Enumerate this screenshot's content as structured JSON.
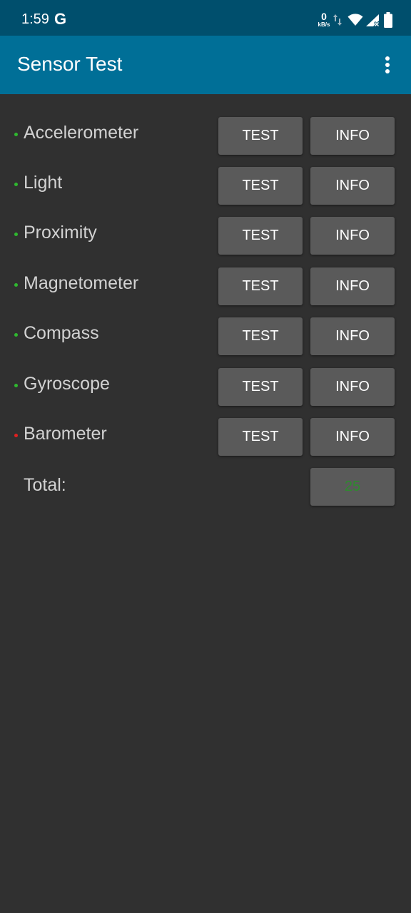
{
  "status_bar": {
    "time": "1:59",
    "g_logo": "G",
    "net_speed_value": "0",
    "net_speed_unit": "kB/s",
    "icons": [
      "data-arrows-icon",
      "wifi-icon",
      "signal-icon",
      "battery-icon"
    ]
  },
  "app_bar": {
    "title": "Sensor Test",
    "menu_icon": "overflow-menu-icon"
  },
  "colors": {
    "status_ok": "#2fb82f",
    "status_fail": "#e02020",
    "total_value": "#2e8b2e",
    "app_bar": "#006f97",
    "status_bar": "#004f6d",
    "background": "#303030",
    "button": "#5a5a5a"
  },
  "sensors": [
    {
      "name": "Accelerometer",
      "status": "ok",
      "test_label": "TEST",
      "info_label": "INFO"
    },
    {
      "name": "Light",
      "status": "ok",
      "test_label": "TEST",
      "info_label": "INFO"
    },
    {
      "name": "Proximity",
      "status": "ok",
      "test_label": "TEST",
      "info_label": "INFO"
    },
    {
      "name": "Magnetometer",
      "status": "ok",
      "test_label": "TEST",
      "info_label": "INFO"
    },
    {
      "name": "Compass",
      "status": "ok",
      "test_label": "TEST",
      "info_label": "INFO"
    },
    {
      "name": "Gyroscope",
      "status": "ok",
      "test_label": "TEST",
      "info_label": "INFO"
    },
    {
      "name": "Barometer",
      "status": "fail",
      "test_label": "TEST",
      "info_label": "INFO"
    }
  ],
  "total": {
    "label": "Total:",
    "value": "25"
  }
}
